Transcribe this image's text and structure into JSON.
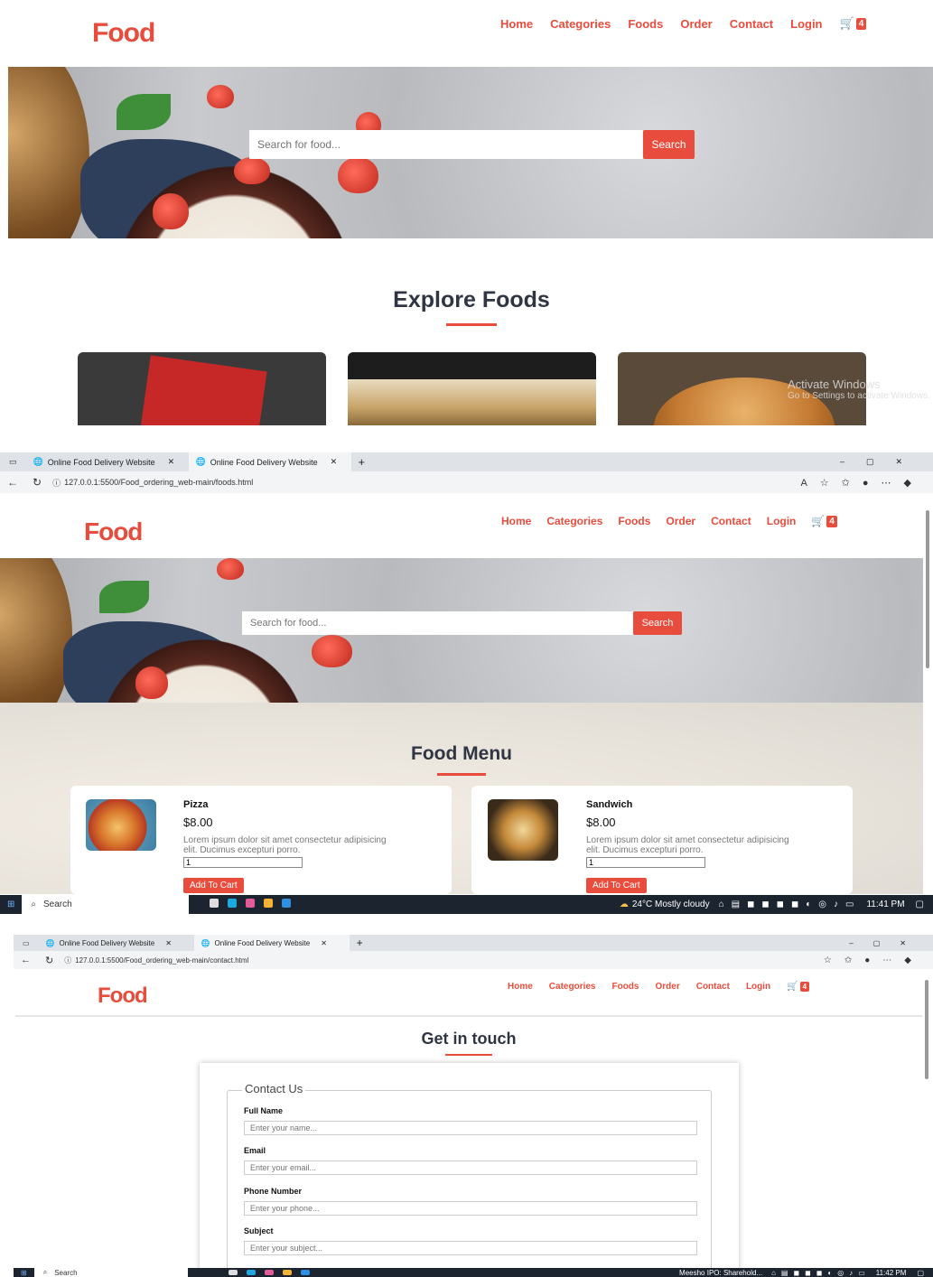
{
  "brand": {
    "logo": "Food",
    "accent": "#e74c3c"
  },
  "nav": {
    "items": [
      "Home",
      "Categories",
      "Foods",
      "Order",
      "Contact",
      "Login"
    ],
    "cart_count": "4"
  },
  "search": {
    "placeholder": "Search for food...",
    "button": "Search"
  },
  "explore": {
    "title": "Explore Foods",
    "watermark_line1": "Activate Windows",
    "watermark_line2": "Go to Settings to activate Windows."
  },
  "browser": {
    "tabs": [
      "Online Food Delivery Website",
      "Online Food Delivery Website"
    ],
    "new_tab": "+",
    "url_foods": "127.0.0.1:5500/Food_ordering_web-main/foods.html",
    "url_contact": "127.0.0.1:5500/Food_ordering_web-main/contact.html"
  },
  "menu": {
    "title": "Food Menu",
    "items": [
      {
        "name": "Pizza",
        "price": "$8.00",
        "desc": "Lorem ipsum dolor sit amet consectetur adipisicing elit. Ducimus excepturi porro.",
        "qty": "1",
        "button": "Add To Cart"
      },
      {
        "name": "Sandwich",
        "price": "$8.00",
        "desc": "Lorem ipsum dolor sit amet consectetur adipisicing elit. Ducimus excepturi porro.",
        "qty": "1",
        "button": "Add To Cart"
      }
    ]
  },
  "taskbar": {
    "search": "Search",
    "weather": "24°C  Mostly cloudy",
    "time1": "11:41 PM",
    "news": "Meesho IPO: Sharehold...",
    "time2": "11:42 PM"
  },
  "contact": {
    "title": "Get in touch",
    "legend": "Contact Us",
    "fields": [
      {
        "label": "Full Name",
        "placeholder": "Enter your name..."
      },
      {
        "label": "Email",
        "placeholder": "Enter your email..."
      },
      {
        "label": "Phone Number",
        "placeholder": "Enter your phone..."
      },
      {
        "label": "Subject",
        "placeholder": "Enter your subject..."
      }
    ]
  }
}
